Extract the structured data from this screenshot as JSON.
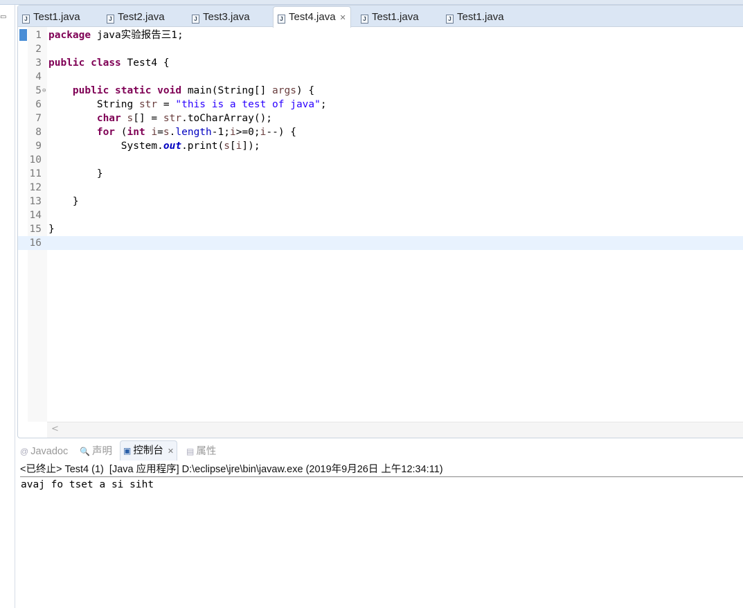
{
  "editor_tabs": [
    {
      "label": "Test1.java",
      "active": false
    },
    {
      "label": "Test2.java",
      "active": false
    },
    {
      "label": "Test3.java",
      "active": false
    },
    {
      "label": "Test4.java",
      "active": true
    },
    {
      "label": "Test1.java",
      "active": false
    },
    {
      "label": "Test1.java",
      "active": false
    }
  ],
  "code_lines": [
    [
      {
        "t": "package",
        "c": "k"
      },
      {
        "t": " java实验报告三1;"
      }
    ],
    [],
    [
      {
        "t": "public",
        "c": "k"
      },
      {
        "t": " "
      },
      {
        "t": "class",
        "c": "k"
      },
      {
        "t": " Test4 {"
      }
    ],
    [],
    [
      {
        "t": "    "
      },
      {
        "t": "public",
        "c": "k"
      },
      {
        "t": " "
      },
      {
        "t": "static",
        "c": "k"
      },
      {
        "t": " "
      },
      {
        "t": "void",
        "c": "k"
      },
      {
        "t": " main(String[] "
      },
      {
        "t": "args",
        "c": "v"
      },
      {
        "t": ") {"
      }
    ],
    [
      {
        "t": "        String "
      },
      {
        "t": "str",
        "c": "v"
      },
      {
        "t": " = "
      },
      {
        "t": "\"this is a test of java\"",
        "c": "s"
      },
      {
        "t": ";"
      }
    ],
    [
      {
        "t": "        "
      },
      {
        "t": "char",
        "c": "k"
      },
      {
        "t": " "
      },
      {
        "t": "s",
        "c": "v"
      },
      {
        "t": "[] = "
      },
      {
        "t": "str",
        "c": "v"
      },
      {
        "t": ".toCharArray();"
      }
    ],
    [
      {
        "t": "        "
      },
      {
        "t": "for",
        "c": "k"
      },
      {
        "t": " ("
      },
      {
        "t": "int",
        "c": "k"
      },
      {
        "t": " "
      },
      {
        "t": "i",
        "c": "v"
      },
      {
        "t": "="
      },
      {
        "t": "s",
        "c": "v"
      },
      {
        "t": "."
      },
      {
        "t": "length",
        "c": "f"
      },
      {
        "t": "-1;"
      },
      {
        "t": "i",
        "c": "v"
      },
      {
        "t": ">=0;"
      },
      {
        "t": "i",
        "c": "v"
      },
      {
        "t": "--) {"
      }
    ],
    [
      {
        "t": "            System."
      },
      {
        "t": "out",
        "c": "sf"
      },
      {
        "t": ".print("
      },
      {
        "t": "s",
        "c": "v"
      },
      {
        "t": "["
      },
      {
        "t": "i",
        "c": "v"
      },
      {
        "t": "]);"
      }
    ],
    [],
    [
      {
        "t": "        }"
      }
    ],
    [],
    [
      {
        "t": "    }"
      }
    ],
    [],
    [
      {
        "t": "}"
      }
    ],
    []
  ],
  "console_tabs": [
    {
      "label": "Javadoc",
      "icon": "@",
      "active": false
    },
    {
      "label": "声明",
      "icon": "declaration-icon",
      "active": false
    },
    {
      "label": "控制台",
      "icon": "console-icon",
      "active": true
    },
    {
      "label": "属性",
      "icon": "properties-icon",
      "active": false
    }
  ],
  "console": {
    "header": "<已终止> Test4 (1)  [Java 应用程序] D:\\eclipse\\jre\\bin\\javaw.exe (2019年9月26日 上午12:34:11)",
    "output": "avaj fo tset a si siht"
  }
}
